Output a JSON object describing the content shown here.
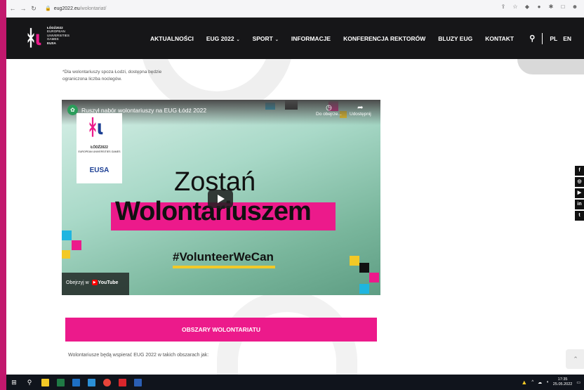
{
  "browser": {
    "url_domain": "eug2022.eu",
    "url_path": "/wolontariat/"
  },
  "logo": {
    "line1": "ŁÓDŹ2022",
    "line2": "EUROPEAN",
    "line3": "UNIVERSITIES",
    "line4": "GAMES",
    "line5": "EUSA"
  },
  "nav": {
    "items": [
      {
        "label": "AKTUALNOŚCI",
        "dropdown": false
      },
      {
        "label": "EUG 2022",
        "dropdown": true
      },
      {
        "label": "SPORT",
        "dropdown": true
      },
      {
        "label": "INFORMACJE",
        "dropdown": false
      },
      {
        "label": "KONFERENCJA REKTORÓW",
        "dropdown": false
      },
      {
        "label": "BLUZY EUG",
        "dropdown": false
      },
      {
        "label": "KONTAKT",
        "dropdown": false
      }
    ],
    "lang_pl": "PL",
    "lang_en": "EN"
  },
  "note": {
    "line1": "*Dla wolontariuszy spoza Łodzi, dostępna będzie",
    "line2": "ograniczona liczba noclegów."
  },
  "video": {
    "title": "Ruszył nabór wolontariuszy na EUG Łódź 2022",
    "watch_later": "Do obejrze...",
    "share": "Udostępnij",
    "card_lodz": "ŁÓDŹ2022",
    "card_sub": "EUROPEAN UNIVERSITIES GAMES",
    "card_eusa": "EUSA",
    "headline1": "Zostań",
    "headline2": "Wolontariuszem",
    "hashtag": "#VolunteerWeCan",
    "watch_on": "Obejrzyj w",
    "youtube": "YouTube"
  },
  "section": {
    "button": "OBSZARY WOLONTARIATU",
    "text": "Wolontariusze będą wspierać EUG 2022 w takich obszarach jak:"
  },
  "taskbar": {
    "time": "17:35",
    "date": "25.05.2022"
  },
  "colors": {
    "brand_pink": "#ec1a8b",
    "header_dark": "#161618"
  }
}
